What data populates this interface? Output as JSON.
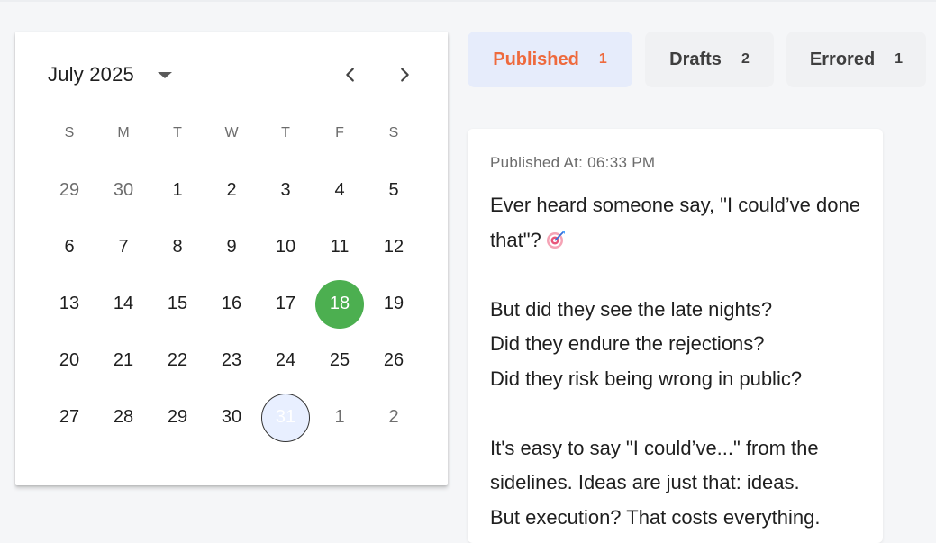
{
  "calendar": {
    "month_label": "July 2025",
    "weekdays": [
      "S",
      "M",
      "T",
      "W",
      "T",
      "F",
      "S"
    ],
    "days": [
      {
        "label": "29",
        "outside": true
      },
      {
        "label": "30",
        "outside": true
      },
      {
        "label": "1"
      },
      {
        "label": "2"
      },
      {
        "label": "3"
      },
      {
        "label": "4"
      },
      {
        "label": "5"
      },
      {
        "label": "6"
      },
      {
        "label": "7"
      },
      {
        "label": "8"
      },
      {
        "label": "9"
      },
      {
        "label": "10"
      },
      {
        "label": "11"
      },
      {
        "label": "12"
      },
      {
        "label": "13"
      },
      {
        "label": "14"
      },
      {
        "label": "15"
      },
      {
        "label": "16"
      },
      {
        "label": "17"
      },
      {
        "label": "18",
        "selected": true
      },
      {
        "label": "19"
      },
      {
        "label": "20"
      },
      {
        "label": "21"
      },
      {
        "label": "22"
      },
      {
        "label": "23"
      },
      {
        "label": "24"
      },
      {
        "label": "25"
      },
      {
        "label": "26"
      },
      {
        "label": "27"
      },
      {
        "label": "28"
      },
      {
        "label": "29"
      },
      {
        "label": "30"
      },
      {
        "label": "31",
        "today": true
      },
      {
        "label": "1",
        "outside": true
      },
      {
        "label": "2",
        "outside": true
      }
    ],
    "prev_icon": "chevron-left-icon",
    "next_icon": "chevron-right-icon",
    "dropdown_icon": "caret-down-icon",
    "selected_color": "#4caf50"
  },
  "tabs": {
    "published": {
      "label": "Published",
      "count": "1",
      "color": "#ee6a3d"
    },
    "drafts": {
      "label": "Drafts",
      "count": "2"
    },
    "errored": {
      "label": "Errored",
      "count": "1"
    }
  },
  "post": {
    "published_at": "Published At: 06:33 PM",
    "line1": "Ever heard someone say, \"I could’ve done that\"?",
    "emoji_icon": "target-dart-icon",
    "line2": "But did they see the late nights?",
    "line3": "Did they endure the rejections?",
    "line4": "Did they risk being wrong in public?",
    "line5": "It's easy to say \"I could’ve...\" from the sidelines. Ideas are just that: ideas.",
    "line6": "But execution? That costs everything."
  }
}
